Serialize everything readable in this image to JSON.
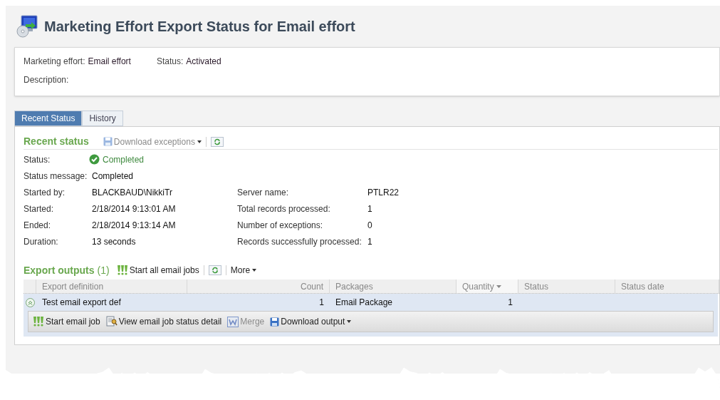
{
  "page": {
    "title": "Marketing Effort Export Status for Email effort"
  },
  "summary": {
    "fields": [
      {
        "label": "Marketing effort:",
        "value": "Email effort"
      },
      {
        "label": "Status:",
        "value": "Activated"
      },
      {
        "label": "Description:"
      }
    ]
  },
  "tabs": [
    {
      "label": "Recent Status",
      "selected": true
    },
    {
      "label": "History",
      "selected": false
    }
  ],
  "recent_status": {
    "title": "Recent status",
    "toolbar": [
      {
        "kind": "save",
        "label": "Download exceptions",
        "dropdown": true,
        "disabled": true
      },
      {
        "kind": "refresh"
      }
    ],
    "status": {
      "label": "Status:",
      "value": "Completed"
    },
    "message": {
      "label": "Status message:",
      "value": "Completed"
    },
    "left_fields": [
      {
        "label": "Started by:",
        "value": "BLACKBAUD\\NikkiTr"
      },
      {
        "label": "Started:",
        "value": "2/18/2014 9:13:01 AM"
      },
      {
        "label": "Ended:",
        "value": "2/18/2014 9:13:14 AM"
      },
      {
        "label": "Duration:",
        "value": "13 seconds"
      }
    ],
    "right_fields": [
      {
        "label": "Server name:",
        "value": "PTLR22"
      },
      {
        "label": "Total records processed:",
        "value": "1"
      },
      {
        "label": "Number of exceptions:",
        "value": "0"
      },
      {
        "label": "Records successfully processed:",
        "value": "1"
      }
    ]
  },
  "export_outputs": {
    "title": "Export outputs",
    "count": "(1)",
    "toolbar": [
      {
        "kind": "start",
        "label": "Start all email jobs"
      },
      {
        "kind": "refresh"
      },
      {
        "kind": "more",
        "label": "More",
        "dropdown": true
      }
    ],
    "table": {
      "columns": [
        {
          "label": "Export definition",
          "sorted": false
        },
        {
          "label": "Count",
          "sorted": false
        },
        {
          "label": "Packages",
          "sorted": false
        },
        {
          "label": "Quantity",
          "sorted": true
        },
        {
          "label": "Status",
          "sorted": false
        },
        {
          "label": "Status date",
          "sorted": false
        }
      ],
      "rows": [
        {
          "expanded": true,
          "cells": [
            "Test email export def",
            "1",
            "Email Package",
            "1"
          ],
          "actions": [
            {
              "kind": "start",
              "label": "Start email job",
              "disabled": false
            },
            {
              "kind": "view",
              "label": "View email job status detail",
              "disabled": false
            },
            {
              "kind": "word",
              "label": "Merge",
              "disabled": true
            },
            {
              "kind": "save",
              "label": "Download output",
              "dropdown": true,
              "disabled": false
            }
          ]
        }
      ]
    }
  }
}
